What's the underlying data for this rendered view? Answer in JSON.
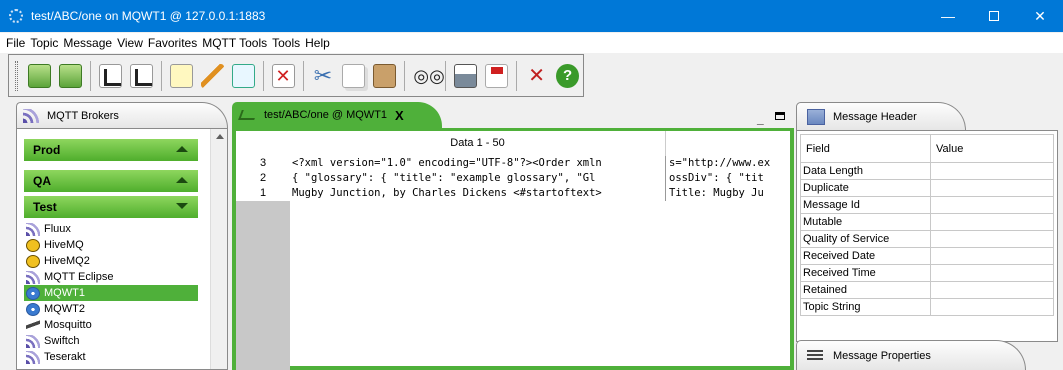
{
  "window": {
    "title": "test/ABC/one on MQWT1 @ 127.0.0.1:1883",
    "minimize_glyph": "—",
    "close_glyph": "✕"
  },
  "menu": [
    "File",
    "Topic",
    "Message",
    "View",
    "Favorites",
    "MQTT Tools",
    "Tools",
    "Help"
  ],
  "toolbar": {
    "icons": [
      "connect-icon",
      "disconnect-icon",
      "subscribe-icon",
      "publish-icon",
      "new-icon",
      "edit-icon",
      "send-icon",
      "delete-icon",
      "cut-icon",
      "copy-icon",
      "paste-icon",
      "find-icon",
      "print-icon",
      "pdf-icon",
      "tools-icon",
      "help-icon"
    ],
    "help_glyph": "?"
  },
  "brokers_panel": {
    "tab_label": "MQTT Brokers",
    "groups": [
      {
        "label": "Prod",
        "state": "collapsed"
      },
      {
        "label": "QA",
        "state": "collapsed"
      },
      {
        "label": "Test",
        "state": "expanded"
      }
    ],
    "items": [
      {
        "label": "Fluux",
        "icon": "broker-icon"
      },
      {
        "label": "HiveMQ",
        "icon": "hive-icon"
      },
      {
        "label": "HiveMQ2",
        "icon": "hive-icon"
      },
      {
        "label": "MQTT Eclipse",
        "icon": "broker-icon"
      },
      {
        "label": "MQWT1",
        "icon": "globe-icon",
        "selected": true
      },
      {
        "label": "MQWT2",
        "icon": "globe-icon"
      },
      {
        "label": "Mosquitto",
        "icon": "mosquitto-icon"
      },
      {
        "label": "Swiftch",
        "icon": "broker-icon"
      },
      {
        "label": "Teserakt",
        "icon": "broker-icon"
      }
    ],
    "selected_color": "#4fb03a"
  },
  "topic_tab": {
    "label": "test/ABC/one @ MQWT1",
    "close_glyph": "X",
    "minimize_glyph": "_",
    "column_header": "Data 1 - 50",
    "rows": [
      {
        "num": "3",
        "col1": "<?xml version=\"1.0\" encoding=\"UTF-8\"?><Order xmln",
        "col2": "s=\"http://www.ex"
      },
      {
        "num": "2",
        "col1": "{ \"glossary\":  { \"title\":  \"example glossary\", \"Gl",
        "col2": "ossDiv\":  { \"tit"
      },
      {
        "num": "1",
        "col1": "Mugby Junction, by Charles Dickens <#startoftext>",
        "col2": "Title:  Mugby Ju"
      }
    ]
  },
  "message_header": {
    "tab_label": "Message Header",
    "columns": [
      "Field",
      "Value"
    ],
    "fields": [
      "Data Length",
      "Duplicate",
      "Message Id",
      "Mutable",
      "Quality of Service",
      "Received Date",
      "Received Time",
      "Retained",
      "Topic String"
    ]
  },
  "message_properties": {
    "tab_label": "Message Properties"
  },
  "colors": {
    "titlebar": "#0078d7",
    "accent_green": "#4fb03a"
  }
}
